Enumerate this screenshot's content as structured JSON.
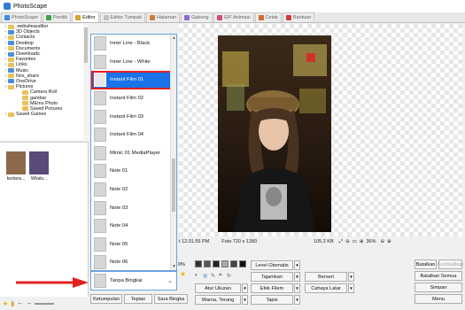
{
  "window": {
    "title": "PhotoScape"
  },
  "tabs": [
    {
      "label": "PhotoScape",
      "color": "#3c8dde",
      "active": false
    },
    {
      "label": "Penilik",
      "color": "#45a04a",
      "active": false
    },
    {
      "label": "Editor",
      "color": "#d9a430",
      "active": true
    },
    {
      "label": "Editor Tumpak",
      "color": "#c0c0c0",
      "active": false
    },
    {
      "label": "Halaman",
      "color": "#d47a3a",
      "active": false
    },
    {
      "label": "Gabung",
      "color": "#8c6ad4",
      "active": false
    },
    {
      "label": "GIF Animasi",
      "color": "#d44a7a",
      "active": false
    },
    {
      "label": "Cetak",
      "color": "#d46a2a",
      "active": false
    },
    {
      "label": "Bantuan",
      "color": "#d43a3a",
      "active": false
    }
  ],
  "folder_tree": [
    {
      "label": ".websiteauditor",
      "depth": 1,
      "color": "#e8c25a"
    },
    {
      "label": "3D Objects",
      "depth": 1,
      "color": "#4a8ed8"
    },
    {
      "label": "Contacts",
      "depth": 1,
      "color": "#e8c25a"
    },
    {
      "label": "Desktop",
      "depth": 1,
      "color": "#4a8ed8"
    },
    {
      "label": "Documents",
      "depth": 1,
      "color": "#e8c25a"
    },
    {
      "label": "Downloads",
      "depth": 1,
      "color": "#4a8ed8"
    },
    {
      "label": "Favorites",
      "depth": 1,
      "color": "#e8c25a"
    },
    {
      "label": "Links",
      "depth": 1,
      "color": "#e8c25a"
    },
    {
      "label": "Music",
      "depth": 1,
      "color": "#4a8ed8"
    },
    {
      "label": "Nox_share",
      "depth": 1,
      "color": "#e8c25a"
    },
    {
      "label": "OneDrive",
      "depth": 1,
      "color": "#4a8ed8"
    },
    {
      "label": "Pictures",
      "depth": 1,
      "color": "#e8c25a"
    },
    {
      "label": "Camera Roll",
      "depth": 2,
      "color": "#e8c25a"
    },
    {
      "label": "gambar",
      "depth": 2,
      "color": "#e8c25a"
    },
    {
      "label": "MEmu Photo",
      "depth": 2,
      "color": "#e8c25a"
    },
    {
      "label": "Saved Pictures",
      "depth": 2,
      "color": "#e8c25a"
    },
    {
      "label": "Saved Games",
      "depth": 1,
      "color": "#e8c25a"
    }
  ],
  "thumbnails": [
    {
      "label": "kertans...",
      "color": "#8a6a4a"
    },
    {
      "label": "Whats...",
      "color": "#5a4a7a"
    }
  ],
  "frames": {
    "items": [
      {
        "label": "Inner Line - Black",
        "selected": false
      },
      {
        "label": "Inner Line - White",
        "selected": false
      },
      {
        "label": "Instant Film 01",
        "selected": true
      },
      {
        "label": "Instant Film 02",
        "selected": false
      },
      {
        "label": "Instant Film 03",
        "selected": false
      },
      {
        "label": "Instant Film 04",
        "selected": false
      },
      {
        "label": "Mimic 01 MediaPlayer",
        "selected": false
      },
      {
        "label": "Note 01",
        "selected": false
      },
      {
        "label": "Note 02",
        "selected": false
      },
      {
        "label": "Note 03",
        "selected": false
      },
      {
        "label": "Note 04",
        "selected": false
      },
      {
        "label": "Note 05",
        "selected": false
      },
      {
        "label": "Note 06",
        "selected": false
      }
    ],
    "selected_value": "Tanpa Bingkai"
  },
  "status": {
    "date": "t 12.01.55 PM",
    "dimensions": "Foto 720 x 1280",
    "filesize": "105.2 KB",
    "zoom": "36%"
  },
  "bottom_tabs": {
    "tab1": "Ketumpulan",
    "tab2": "Tepian",
    "tab3": "Sara Bingka"
  },
  "tools": {
    "auto_level": "Level Otomatis",
    "sharpen": "Tajamkan",
    "film_effect": "Efek Filem",
    "auto_contrast": "Atur Ukuran",
    "warm": "Warna, Terang",
    "bright": "Terang",
    "backlight": "Cahaya Latar",
    "flip": "Tapis",
    "rotate": "Berseri",
    "opacity_label": "0%"
  },
  "actions": {
    "undo": "Batalkan",
    "redo": "Kembalikan",
    "undo_all": "Batalkan Semua",
    "save": "Simpan",
    "menu": "Menu"
  },
  "colors": {
    "accent": "#1a73e8",
    "highlight_box": "#e02020",
    "annotation_arrow": "#e02020"
  }
}
